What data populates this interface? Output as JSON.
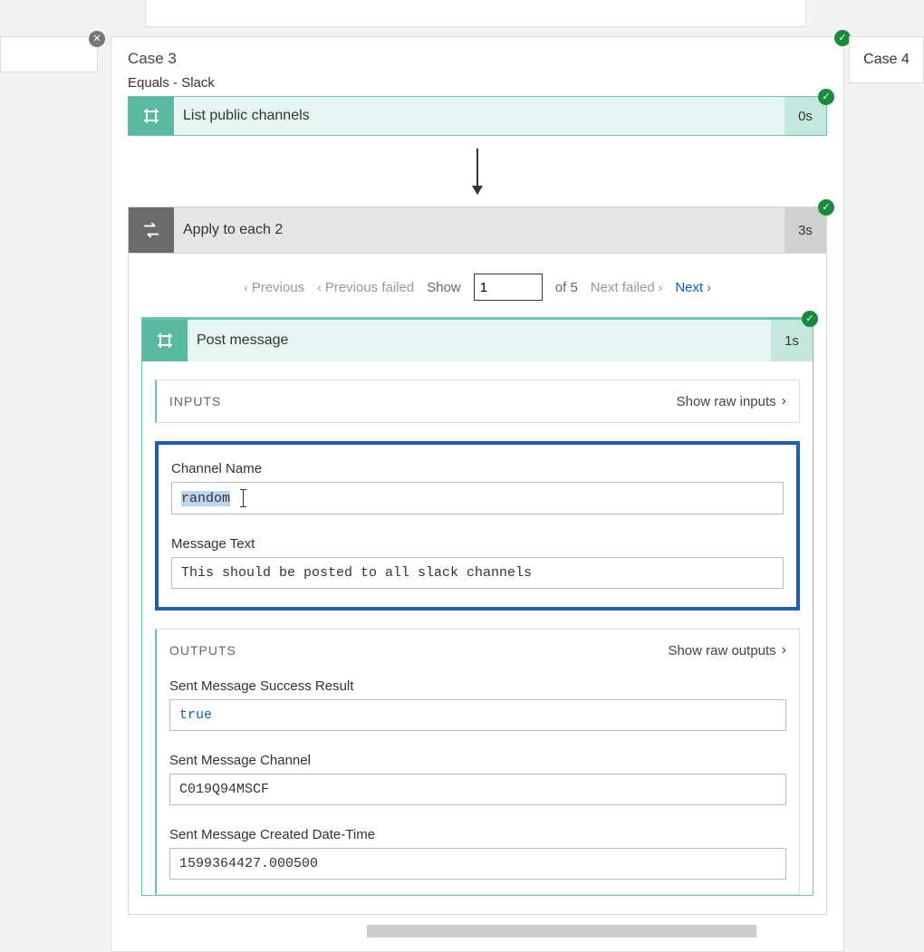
{
  "case": {
    "title": "Case 3",
    "connector_label": "Equals - Slack"
  },
  "list_channels": {
    "label": "List public channels",
    "timing": "0s"
  },
  "loop": {
    "label": "Apply to each 2",
    "timing": "3s"
  },
  "pager": {
    "prev": "Previous",
    "prev_failed": "Previous failed",
    "show": "Show",
    "value": "1",
    "of": "of 5",
    "next_failed": "Next failed",
    "next": "Next"
  },
  "post_message": {
    "label": "Post message",
    "timing": "1s"
  },
  "inputs": {
    "title": "INPUTS",
    "raw": "Show raw inputs",
    "channel_name_label": "Channel Name",
    "channel_name_value": "random",
    "message_text_label": "Message Text",
    "message_text_value": "This should be posted to all slack channels"
  },
  "outputs": {
    "title": "OUTPUTS",
    "raw": "Show raw outputs",
    "success_label": "Sent Message Success Result",
    "success_value": "true",
    "channel_label": "Sent Message Channel",
    "channel_value": "C019Q94MSCF",
    "created_label": "Sent Message Created Date-Time",
    "created_value": "1599364427.000500"
  },
  "right_case": "Case 4"
}
